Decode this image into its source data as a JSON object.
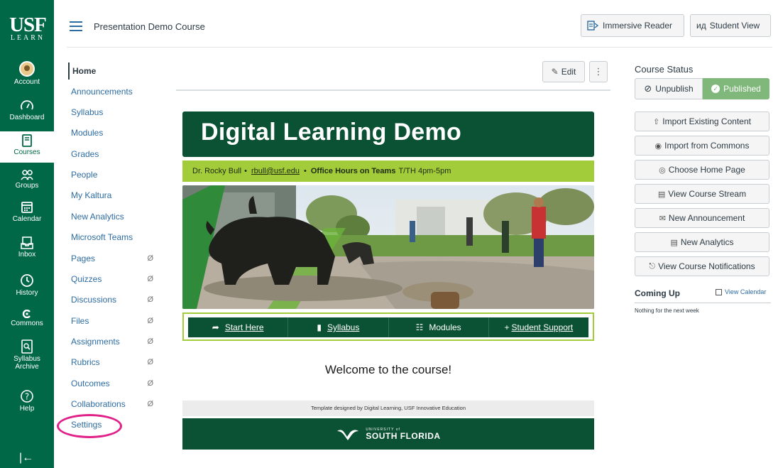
{
  "global_nav": {
    "logo_top": "USF",
    "logo_bottom": "LEARN",
    "items": [
      {
        "label": "Account",
        "icon": "avatar"
      },
      {
        "label": "Dashboard",
        "icon": "dashboard-icon"
      },
      {
        "label": "Courses",
        "icon": "book-icon"
      },
      {
        "label": "Groups",
        "icon": "groups-icon"
      },
      {
        "label": "Calendar",
        "icon": "calendar-icon"
      },
      {
        "label": "Inbox",
        "icon": "inbox-icon"
      },
      {
        "label": "History",
        "icon": "clock-icon"
      },
      {
        "label": "Commons",
        "icon": "commons-icon"
      },
      {
        "label": "Syllabus",
        "label2": "Archive",
        "icon": "syllabus-archive-icon"
      },
      {
        "label": "Help",
        "icon": "help-icon"
      }
    ],
    "collapse_icon": "collapse-arrow-icon"
  },
  "header": {
    "breadcrumb": "Presentation Demo Course",
    "immersive_reader": "Immersive Reader",
    "student_view": "Student View"
  },
  "course_nav": [
    {
      "label": "Home",
      "hidden": false
    },
    {
      "label": "Announcements",
      "hidden": false
    },
    {
      "label": "Syllabus",
      "hidden": false
    },
    {
      "label": "Modules",
      "hidden": false
    },
    {
      "label": "Grades",
      "hidden": false
    },
    {
      "label": "People",
      "hidden": false
    },
    {
      "label": "My Kaltura",
      "hidden": false
    },
    {
      "label": "New Analytics",
      "hidden": false
    },
    {
      "label": "Microsoft Teams",
      "hidden": false
    },
    {
      "label": "Pages",
      "hidden": true
    },
    {
      "label": "Quizzes",
      "hidden": true
    },
    {
      "label": "Discussions",
      "hidden": true
    },
    {
      "label": "Files",
      "hidden": true
    },
    {
      "label": "Assignments",
      "hidden": true
    },
    {
      "label": "Rubrics",
      "hidden": true
    },
    {
      "label": "Outcomes",
      "hidden": true
    },
    {
      "label": "Collaborations",
      "hidden": true
    },
    {
      "label": "Settings",
      "hidden": false
    }
  ],
  "main": {
    "edit_label": "Edit",
    "more_label": "⋮",
    "banner_title": "Digital Learning Demo",
    "info": {
      "instructor": "Dr. Rocky Bull",
      "email": "rbull@usf.edu",
      "office_bold": "Office Hours on Teams",
      "office_time": "T/TH 4pm-5pm"
    },
    "quick_links": [
      {
        "label": "Start Here",
        "icon": "arrow-share-icon",
        "underline": true
      },
      {
        "label": "Syllabus",
        "icon": "document-icon",
        "underline": true
      },
      {
        "label": "Modules",
        "icon": "modules-icon",
        "underline": false
      },
      {
        "label": "Student Support",
        "icon": "plus-icon",
        "underline": true
      }
    ],
    "welcome": "Welcome to the course!",
    "credit": "Template designed by Digital Learning, USF Innovative Education",
    "footer_small": "UNIVERSITY of",
    "footer_big": "SOUTH FLORIDA"
  },
  "sidebar": {
    "status_title": "Course Status",
    "unpublish": "Unpublish",
    "published": "Published",
    "actions": [
      {
        "label": "Import Existing Content",
        "icon": "import-icon"
      },
      {
        "label": "Import from Commons",
        "icon": "commons-icon"
      },
      {
        "label": "Choose Home Page",
        "icon": "target-icon"
      },
      {
        "label": "View Course Stream",
        "icon": "stream-icon"
      },
      {
        "label": "New Announcement",
        "icon": "megaphone-icon"
      },
      {
        "label": "New Analytics",
        "icon": "analytics-icon"
      },
      {
        "label": "View Course Notifications",
        "icon": "bell-icon"
      }
    ],
    "coming_up": "Coming Up",
    "view_calendar": "View Calendar",
    "nothing": "Nothing for the next week"
  },
  "colors": {
    "usf_green": "#006747",
    "banner_green": "#0b5133",
    "lime": "#a3cc3a",
    "published_green": "#7fb87a",
    "link_blue": "#2d6ca2",
    "highlight_magenta": "#e0218a"
  }
}
